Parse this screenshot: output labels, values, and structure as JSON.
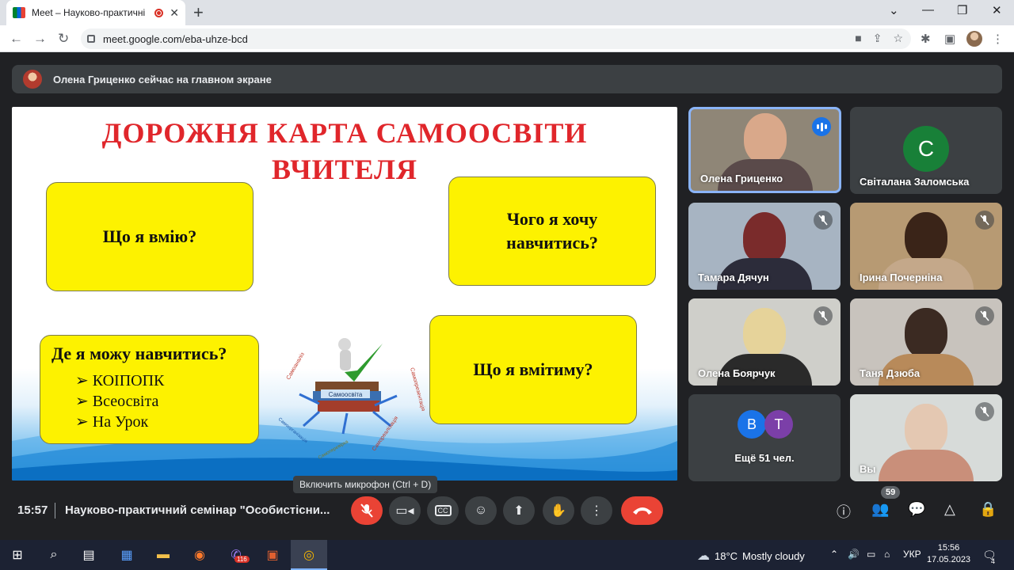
{
  "browser": {
    "tab_title": "Meet – Науково-практичні",
    "tab_close": "✕",
    "new_tab": "+",
    "url": "meet.google.com/eba-uhze-bcd",
    "window_controls": [
      "⌄",
      "—",
      "❐",
      "✕"
    ]
  },
  "banner": {
    "text": "Олена Гриценко сейчас на главном экране"
  },
  "slide": {
    "title_line1": "ДОРОЖНЯ КАРТА САМООСВІТИ",
    "title_line2": "ВЧИТЕЛЯ",
    "box_can": "Що я вмію?",
    "box_want": "Чого я хочу навчитись?",
    "box_where": "Де я можу навчитись?",
    "box_where_items": [
      "КОІПОПК",
      "Всеосвіта",
      "На Урок"
    ],
    "box_will": "Що я вмітиму?",
    "center_label": "Самоосвіта",
    "radial_labels": [
      "Самоаналіз",
      "Самоорганізація",
      "Самореалізація",
      "Самоперевірка",
      "Самовиховання",
      "Самопрезентація"
    ]
  },
  "participants": [
    {
      "name": "Олена Гриценко",
      "state": "speaking"
    },
    {
      "name": "Світалана Заломська",
      "initial": "С",
      "avatar_color": "#188038"
    },
    {
      "name": "Тамара Дячун",
      "state": "muted"
    },
    {
      "name": "Ірина Почерніна",
      "state": "muted"
    },
    {
      "name": "Олена Боярчук",
      "state": "muted"
    },
    {
      "name": "Таня Дзюба",
      "state": "muted"
    },
    {
      "name": "Ещё 51 чел.",
      "initials": [
        "В",
        "Т"
      ],
      "avatar_colors": [
        "#1a73e8",
        "#7b3fa8"
      ]
    },
    {
      "name": "Вы",
      "state": "muted"
    }
  ],
  "tooltip": "Включить микрофон (Ctrl + D)",
  "bottom_bar": {
    "time": "15:57",
    "meeting_title": "Науково-практичний семінар \"Особистісни...",
    "participants_count": "59"
  },
  "taskbar": {
    "weather_temp": "18°C",
    "weather_text": "Mostly cloudy",
    "lang": "УКР",
    "clock_time": "15:56",
    "clock_date": "17.05.2023",
    "viber_badge": "116",
    "notif_count": "4"
  },
  "colors": {
    "meet_bg": "#202124",
    "hangup": "#ea4335",
    "slide_title": "#e0262b",
    "box_yellow": "#fdf200"
  }
}
